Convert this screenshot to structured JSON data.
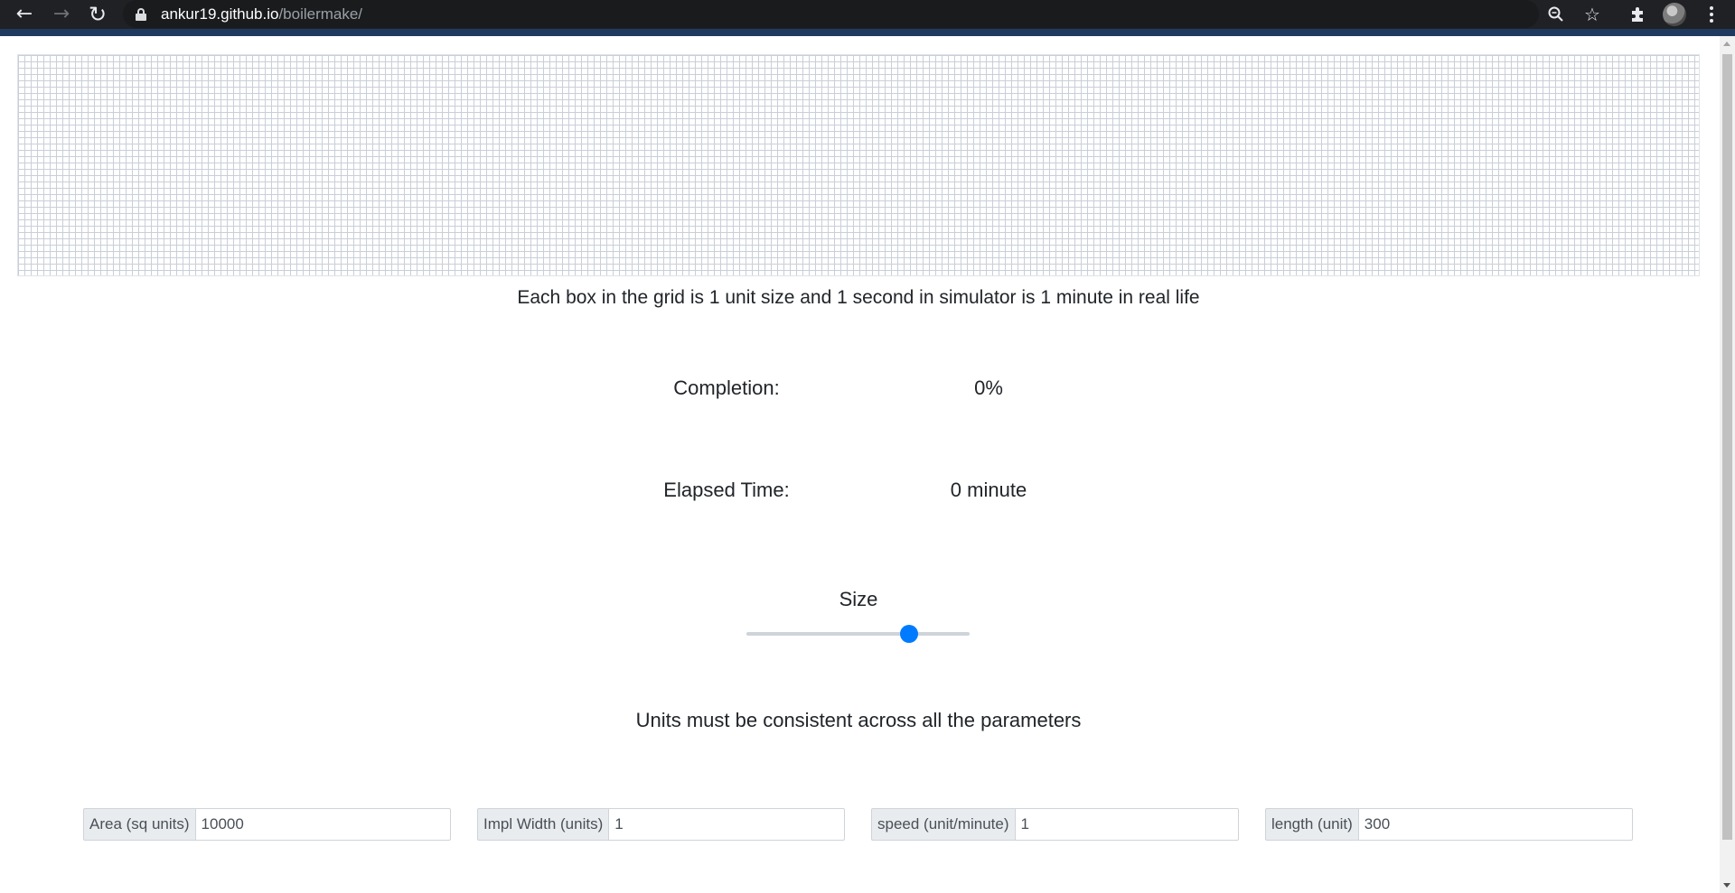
{
  "browser": {
    "url_host": "ankur19.github.io",
    "url_path": "/boilermake/",
    "icons": [
      "back-arrow-icon",
      "forward-arrow-icon",
      "reload-icon",
      "lock-icon",
      "zoom-icon",
      "star-icon",
      "extensions-icon",
      "avatar",
      "menu-icon"
    ]
  },
  "page": {
    "caption": "Each box in the grid is 1 unit size and 1 second in simulator is 1 minute in real life",
    "completion": {
      "label": "Completion:",
      "value": "0%"
    },
    "elapsed": {
      "label": "Elapsed Time:",
      "value": "0 minute"
    },
    "size": {
      "label": "Size",
      "value_fraction": 0.75
    },
    "note": "Units must be consistent across all the parameters",
    "inputs": [
      {
        "label": "Area (sq units)",
        "value": "10000"
      },
      {
        "label": "Impl Width (units)",
        "value": "1"
      },
      {
        "label": "speed (unit/minute)",
        "value": "1"
      },
      {
        "label": "length (unit)",
        "value": "300"
      }
    ]
  },
  "colors": {
    "accent": "#007bff",
    "grid_line": "#c9cfd8",
    "chrome_bg": "#202124"
  }
}
